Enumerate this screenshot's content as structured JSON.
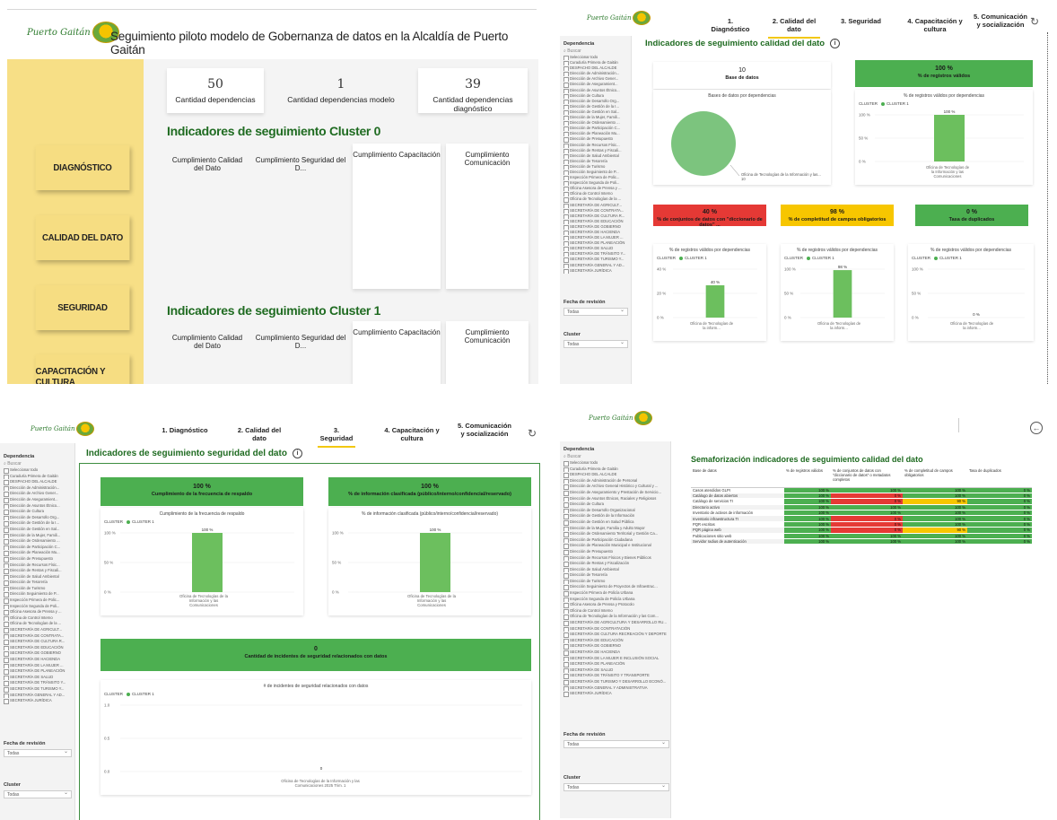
{
  "brand": {
    "logo_text": "Puerto Gaitán",
    "logo_sub": "Puerto Gaitán"
  },
  "colors": {
    "green": "#4caf50",
    "red": "#e53935",
    "yellow": "#f7c600",
    "nav_yellow": "#f7df86",
    "title_green": "#1f6b21"
  },
  "panel1": {
    "header_title": "Seguimiento piloto modelo de Gobernanza de datos en la Alcaldía de Puerto Gaitán",
    "nav": [
      "DIAGNÓSTICO",
      "CALIDAD DEL DATO",
      "SEGURIDAD",
      "CAPACITACIÓN Y CULTURA"
    ],
    "kpis": [
      {
        "value": "50",
        "label": "Cantidad dependencias"
      },
      {
        "value": "1",
        "label": "Cantidad dependencias modelo"
      },
      {
        "value": "39",
        "label": "Cantidad dependencias diagnóstico"
      }
    ],
    "section0_title": "Indicadores de seguimiento Cluster 0",
    "section1_title": "Indicadores de seguimiento Cluster 1",
    "card_titles": [
      "Cumplimiento Calidad del Dato",
      "Cumplimiento Seguridad del D...",
      "Cumplimiento Capacitación",
      "Cumplimiento Comunicación"
    ]
  },
  "tabs": [
    "1. Diagnóstico",
    "2. Calidad del dato",
    "3. Seguridad",
    "4. Capacitación y cultura",
    "5. Comunicación y socialización"
  ],
  "filters": {
    "dependencia_label": "Dependencia",
    "search_placeholder": "Buscar",
    "fecha_label": "Fecha de revisión",
    "fecha_value": "Todas",
    "cluster_label": "Cluster",
    "cluster_value": "Todas",
    "items_short": [
      "Seleccionar todo",
      "Curaduría Primera de Gaitán",
      "DESPACHO DEL ALCALDE",
      "Dirección de Administración...",
      "Dirección de Archivo Gener...",
      "Dirección de Aseguramient...",
      "Dirección de Asuntos Étnico...",
      "Dirección de Cultura",
      "Dirección de Desarrollo Org...",
      "Dirección de Gestión de la I...",
      "Dirección de Gestión en Sal...",
      "Dirección de la Mujer, Famili...",
      "Dirección de Ordenamiento ...",
      "Dirección de Participación C...",
      "Dirección de Planeación Mu...",
      "Dirección de Presupuesto",
      "Dirección de Recursos Físic...",
      "Dirección de Rentas y Fiscali...",
      "Dirección de Salud Ambiental",
      "Dirección de Tesorería",
      "Dirección de Turismo",
      "Dirección Seguimiento de P...",
      "Inspección Primera de Polic...",
      "Inspección Segunda de Poli...",
      "Oficina Asesora de Prensa y ...",
      "Oficina de Control Interno",
      "Oficina de Tecnologías de la ...",
      "SECRETARÍA DE AGRICULT...",
      "SECRETARÍA DE CONTRATA...",
      "SECRETARÍA DE CULTURA R...",
      "SECRETARÍA DE EDUCACIÓN",
      "SECRETARÍA DE GOBIERNO",
      "SECRETARÍA DE HACIENDA",
      "SECRETARÍA DE LA MUJER ...",
      "SECRETARÍA DE PLANEACIÓN",
      "SECRETARÍA DE SALUD",
      "SECRETARÍA DE TRÁNSITO Y...",
      "SECRETARÍA DE TURISMO Y...",
      "SECRETARÍA GENERAL Y AD...",
      "SECRETARÍA JURÍDICA"
    ],
    "items_long": [
      "Seleccionar todo",
      "Curaduría Primera de Gaitán",
      "DESPACHO DEL ALCALDE",
      "Dirección de Administración de Personal",
      "Dirección de Archivo General Histórico y Cultural y ...",
      "Dirección de Aseguramiento y Prestación de Servicio...",
      "Dirección de Asuntos Étnicos, Raciales y Religiosos",
      "Dirección de Cultura",
      "Dirección de Desarrollo Organizacional",
      "Dirección de Gestión de la Información",
      "Dirección de Gestión en Salud Pública",
      "Dirección de la Mujer, Familia y Adulto Mayor",
      "Dirección de Ordenamiento Territorial y Gestión Ca...",
      "Dirección de Participación Ciudadana",
      "Dirección de Planeación Municipal e Institucional",
      "Dirección de Presupuesto",
      "Dirección de Recursos Físicos y Bienes Públicos",
      "Dirección de Rentas y Fiscalización",
      "Dirección de Salud Ambiental",
      "Dirección de Tesorería",
      "Dirección de Turismo",
      "Dirección Seguimiento de Proyectos de Infraestruc...",
      "Inspección Primera de Policía Urbana",
      "Inspección Segunda de Policía Urbana",
      "Oficina Asesora de Prensa y Protocolo",
      "Oficina de Control Interno",
      "Oficina de Tecnologías de la Información y las Com...",
      "SECRETARÍA DE AGRICULTURA Y DESARROLLO RU...",
      "SECRETARÍA DE CONTRATACIÓN",
      "SECRETARÍA DE CULTURA RECREACIÓN Y DEPORTE",
      "SECRETARÍA DE EDUCACIÓN",
      "SECRETARÍA DE GOBIERNO",
      "SECRETARÍA DE HACIENDA",
      "SECRETARÍA DE LA MUJER E INCLUSIÓN SOCIAL",
      "SECRETARÍA DE PLANEACIÓN",
      "SECRETARÍA DE SALUD",
      "SECRETARÍA DE TRÁNSITO Y TRANSPORTE",
      "SECRETARÍA DE TURISMO Y DESARROLLO ECONÓ...",
      "SECRETARÍA GENERAL Y ADMINISTRATIVA",
      "SECRETARÍA JURÍDICA"
    ]
  },
  "panel2": {
    "title": "Indicadores de seguimiento calidad del dato",
    "base_value": "10",
    "base_label": "Base de datos",
    "valid_value": "100 %",
    "valid_label": "% de registros válidos",
    "dict_value": "40 %",
    "dict_label": "% de conjuntos de datos con \"diccionario de datos\" ...",
    "compl_value": "98 %",
    "compl_label": "% de completitud de campos obligatorios",
    "dup_value": "0 %",
    "dup_label": "Tasa de duplicados",
    "pie_title": "Bases de datos por dependencias",
    "pie_label": "Oficina de Tecnologías de la Información y las...",
    "pie_count": "10",
    "bar_titles": [
      "% de registros válidos por dependencias",
      "% de registros válidos por dependencias",
      "% de registros válidos por dependencias",
      "% de registros válidos por dependencias"
    ],
    "legend_key": "CLUSTER",
    "legend_item": "CLUSTER 1",
    "bar_cat_full": "Oficina de Tecnologías de la Información y las Comunicaciones",
    "bar_cat_short": "Oficina de Tecnologías de la inform..."
  },
  "panel3": {
    "title": "Indicadores de seguimiento seguridad del dato",
    "freq_value": "100 %",
    "freq_label": "Cumplimiento de la frecuencia de respaldo",
    "class_value": "100 %",
    "class_label": "% de información clasificada (público/interno/confidencial/reservado)",
    "inc_value": "0",
    "inc_label": "Cantidad de incidentes de seguridad relacionados con datos",
    "chart1_title": "Cumplimiento de la frecuencia de respaldo",
    "chart2_title": "% de información clasificada (público/interno/confidencial/reservado)",
    "chart3_title": "# de incidentes de seguridad relacionados con datos",
    "chart3_cat": "Oficina de Tecnologías de la Información y las Comunicaciones 2025 Trim. 1"
  },
  "panel4": {
    "title": "Semaforización indicadores de seguimiento calidad del dato",
    "headers": [
      "Base de datos",
      "% de registros válidos",
      "% de conjuntos de datos con \"diccionario de datos\" o metadatos completos",
      "% de completitud de campos obligatorios",
      "Tasa de duplicados"
    ],
    "rows": [
      {
        "name": "Casos atendidos GLPI",
        "c": [
          "100 %",
          "100 %",
          "100 %",
          "0 %"
        ],
        "s": [
          "g",
          "g",
          "g",
          "g"
        ]
      },
      {
        "name": "Catálogo de datos abiertos",
        "c": [
          "100 %",
          "0 %",
          "100 %",
          "0 %"
        ],
        "s": [
          "g",
          "r",
          "g",
          "g"
        ]
      },
      {
        "name": "Catálogo de servicios TI",
        "c": [
          "100 %",
          "0 %",
          "90 %",
          "0 %"
        ],
        "s": [
          "g",
          "r",
          "y",
          "g"
        ]
      },
      {
        "name": "Directorio activo",
        "c": [
          "100 %",
          "100 %",
          "100 %",
          "0 %"
        ],
        "s": [
          "g",
          "g",
          "g",
          "g"
        ]
      },
      {
        "name": "Inventario de activos de información",
        "c": [
          "100 %",
          "100 %",
          "100 %",
          "0 %"
        ],
        "s": [
          "g",
          "g",
          "g",
          "g"
        ]
      },
      {
        "name": "Inventario infraestructura TI",
        "c": [
          "100 %",
          "0 %",
          "100 %",
          "0 %"
        ],
        "s": [
          "g",
          "r",
          "g",
          "g"
        ]
      },
      {
        "name": "PQR escritas",
        "c": [
          "100 %",
          "0 %",
          "100 %",
          "0 %"
        ],
        "s": [
          "g",
          "r",
          "g",
          "g"
        ]
      },
      {
        "name": "PQR página web",
        "c": [
          "100 %",
          "0 %",
          "90 %",
          "0 %"
        ],
        "s": [
          "g",
          "r",
          "y",
          "g"
        ]
      },
      {
        "name": "Publicaciones sitio web",
        "c": [
          "100 %",
          "100 %",
          "100 %",
          "0 %"
        ],
        "s": [
          "g",
          "g",
          "g",
          "g"
        ]
      },
      {
        "name": "Servidor radius de autenticación",
        "c": [
          "100 %",
          "100 %",
          "100 %",
          "0 %"
        ],
        "s": [
          "g",
          "g",
          "g",
          "g"
        ]
      }
    ]
  },
  "chart_data": [
    {
      "type": "pie",
      "title": "Bases de datos por dependencias",
      "slices": [
        {
          "label": "Oficina de Tecnologías de la Información y las...",
          "value": 10
        }
      ]
    },
    {
      "type": "bar",
      "title": "% de registros válidos por dependencias",
      "categories": [
        "Oficina de Tecnologías de la Información y las Comunicaciones"
      ],
      "values": [
        100
      ],
      "ylim": [
        0,
        100
      ],
      "yticks": [
        "0 %",
        "50 %",
        "100 %"
      ],
      "legend": "CLUSTER 1"
    },
    {
      "type": "bar",
      "title": "% de registros válidos por dependencias",
      "categories": [
        "Oficina de Tecnologías de la inform..."
      ],
      "values": [
        40
      ],
      "ylim": [
        0,
        60
      ],
      "yticks": [
        "0 %",
        "20 %",
        "40 %"
      ],
      "legend": "CLUSTER 1"
    },
    {
      "type": "bar",
      "title": "% de registros válidos por dependencias",
      "categories": [
        "Oficina de Tecnologías de la inform..."
      ],
      "values": [
        98
      ],
      "ylim": [
        0,
        100
      ],
      "yticks": [
        "0 %",
        "50 %",
        "100 %"
      ],
      "legend": "CLUSTER 1"
    },
    {
      "type": "bar",
      "title": "% de registros válidos por dependencias",
      "categories": [
        "Oficina de Tecnologías de la inform..."
      ],
      "values": [
        0
      ],
      "ylim": [
        0,
        100
      ],
      "yticks": [
        "0 %",
        "50 %",
        "100 %"
      ],
      "legend": "CLUSTER 1"
    },
    {
      "type": "bar",
      "title": "Cumplimiento de la frecuencia de respaldo",
      "categories": [
        "Oficina de Tecnologías de la Información y las Comunicaciones"
      ],
      "values": [
        100
      ],
      "ylim": [
        0,
        100
      ],
      "yticks": [
        "0 %",
        "50 %",
        "100 %"
      ],
      "legend": "CLUSTER 1"
    },
    {
      "type": "bar",
      "title": "% de información clasificada (público/interno/confidencial/reservado)",
      "categories": [
        "Oficina de Tecnologías de la Información y las Comunicaciones"
      ],
      "values": [
        100
      ],
      "ylim": [
        0,
        100
      ],
      "yticks": [
        "0 %",
        "50 %",
        "100 %"
      ],
      "legend": "CLUSTER 1"
    },
    {
      "type": "bar",
      "title": "# de incidentes de seguridad relacionados con datos",
      "categories": [
        "Oficina de Tecnologías de la Información y las Comunicaciones 2025 Trim. 1"
      ],
      "values": [
        0
      ],
      "ylim": [
        0,
        1
      ],
      "yticks": [
        "0.0",
        "0.5",
        "1.0"
      ],
      "legend": "CLUSTER 1"
    }
  ]
}
